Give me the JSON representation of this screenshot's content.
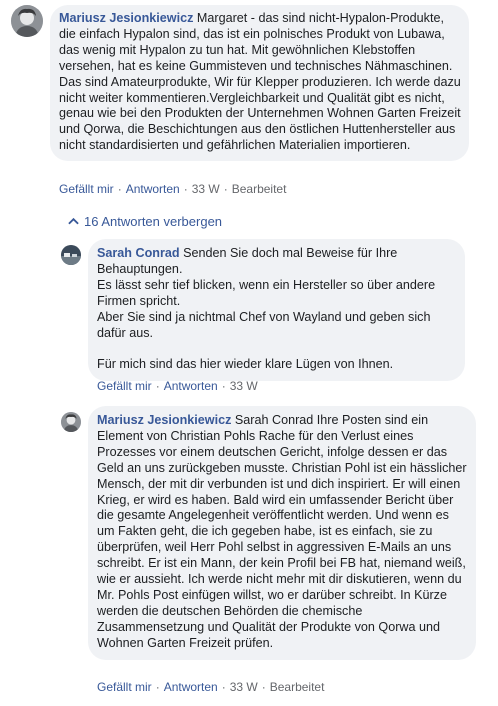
{
  "comments": [
    {
      "author": "Mariusz Jesionkiewicz",
      "text": " Margaret - das sind nicht-Hypalon-Produkte, die einfach Hypalon sind, das ist ein polnisches Produkt von Lubawa, das wenig mit Hypalon zu tun hat. Mit gewöhnlichen Klebstoffen versehen, hat es keine Gummisteven und technisches Nähmaschinen. Das sind Amateurprodukte, Wir für Klepper produzieren. Ich werde dazu nicht weiter kommentieren.Vergleichbarkeit und Qualität gibt es nicht, genau wie bei den Produkten der Unternehmen Wohnen Garten Freizeit und Qorwa, die Beschichtungen aus den östlichen Huttenhersteller aus nicht standardisierten und gefährlichen Materialien importieren.",
      "actions": {
        "like": "Gefällt mir",
        "reply": "Antworten",
        "time": "33 W",
        "edited": "Bearbeitet"
      }
    },
    {
      "author": "Sarah Conrad",
      "text": " Senden Sie doch mal Beweise für Ihre Behauptungen.\nEs lässt sehr tief blicken, wenn ein Hersteller so über andere Firmen spricht.\nAber Sie sind ja nichtmal Chef von Wayland und geben sich dafür aus.\n\nFür mich sind das hier wieder klare Lügen von Ihnen.",
      "actions": {
        "like": "Gefällt mir",
        "reply": "Antworten",
        "time": "33 W"
      }
    },
    {
      "author": "Mariusz Jesionkiewicz",
      "text": " Sarah Conrad Ihre Posten sind ein Element von Christian Pohls Rache für den Verlust eines Prozesses vor einem deutschen Gericht, infolge dessen er das Geld an uns zurückgeben musste. Christian Pohl ist ein hässlicher Mensch, der mit dir verbunden ist und dich inspiriert. Er will einen Krieg, er wird es haben. Bald wird ein umfassender Bericht über die gesamte Angelegenheit veröffentlicht werden. Und wenn es um Fakten geht, die ich gegeben habe, ist es einfach, sie zu überprüfen, weil Herr Pohl selbst in aggressiven E-Mails an uns schreibt. Er ist ein Mann, der kein Profil bei FB hat, niemand weiß, wie er aussieht. Ich werde nicht mehr mit dir diskutieren, wenn du Mr. Pohls Post einfügen willst, wo er darüber schreibt. In Kürze werden die deutschen Behörden die chemische Zusammensetzung und Qualität der Produkte von Qorwa und Wohnen Garten Freizeit prüfen.",
      "actions": {
        "like": "Gefällt mir",
        "reply": "Antworten",
        "time": "33 W",
        "edited": "Bearbeitet"
      }
    }
  ],
  "replies_toggle": {
    "label": "16 Antworten verbergen",
    "icon": "chevron-up-icon"
  },
  "separator": "·",
  "colors": {
    "link": "#385898",
    "bubble": "#f0f2f5",
    "meta": "#65676b"
  }
}
